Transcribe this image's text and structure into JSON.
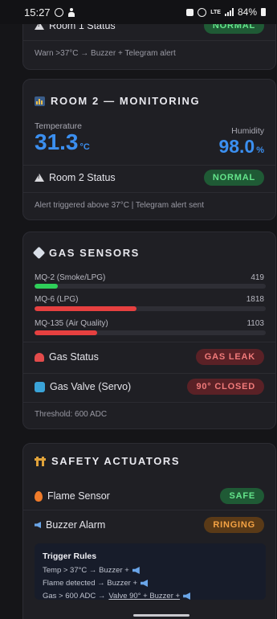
{
  "status_bar": {
    "time": "15:27",
    "battery": "84%",
    "network": "LTE"
  },
  "room1": {
    "status_label": "Room 1 Status",
    "status_value": "NORMAL",
    "note": "Warn >37°C → Buzzer + Telegram alert"
  },
  "room2": {
    "title": "ROOM 2 — MONITORING",
    "temp_label": "Temperature",
    "temp_value": "31.3",
    "temp_unit": "°C",
    "humidity_label": "Humidity",
    "humidity_value": "98.0",
    "humidity_unit": "%",
    "status_label": "Room 2 Status",
    "status_value": "NORMAL",
    "note": "Alert triggered above 37°C | Telegram alert sent"
  },
  "gas": {
    "title": "GAS SENSORS",
    "sensors": [
      {
        "label": "MQ-2 (Smoke/LPG)",
        "value": "419",
        "fill_pct": 10,
        "color": "#2fcf5a"
      },
      {
        "label": "MQ-6 (LPG)",
        "value": "1818",
        "fill_pct": 44,
        "color": "#e64040"
      },
      {
        "label": "MQ-135 (Air Quality)",
        "value": "1103",
        "fill_pct": 27,
        "color": "#e64040"
      }
    ],
    "status_label": "Gas Status",
    "status_value": "GAS LEAK",
    "valve_label": "Gas Valve (Servo)",
    "valve_value": "90° CLOSED",
    "threshold": "Threshold: 600 ADC"
  },
  "safety": {
    "title": "SAFETY ACTUATORS",
    "flame_label": "Flame Sensor",
    "flame_value": "SAFE",
    "buzzer_label": "Buzzer Alarm",
    "buzzer_value": "RINGING",
    "trigger_title": "Trigger Rules",
    "rule1": "Temp > 37°C → Buzzer +",
    "rule2": "Flame detected → Buzzer +",
    "rule3_prefix": "Gas > 600 ADC →",
    "rule3_link": "Valve 90° + Buzzer +"
  },
  "colors": {
    "temp_value": "#3b8ff0",
    "humidity_value": "#3b8ff0",
    "accent_green": "#64e58b",
    "accent_red": "#f17a7a",
    "accent_orange": "#f5a344"
  }
}
